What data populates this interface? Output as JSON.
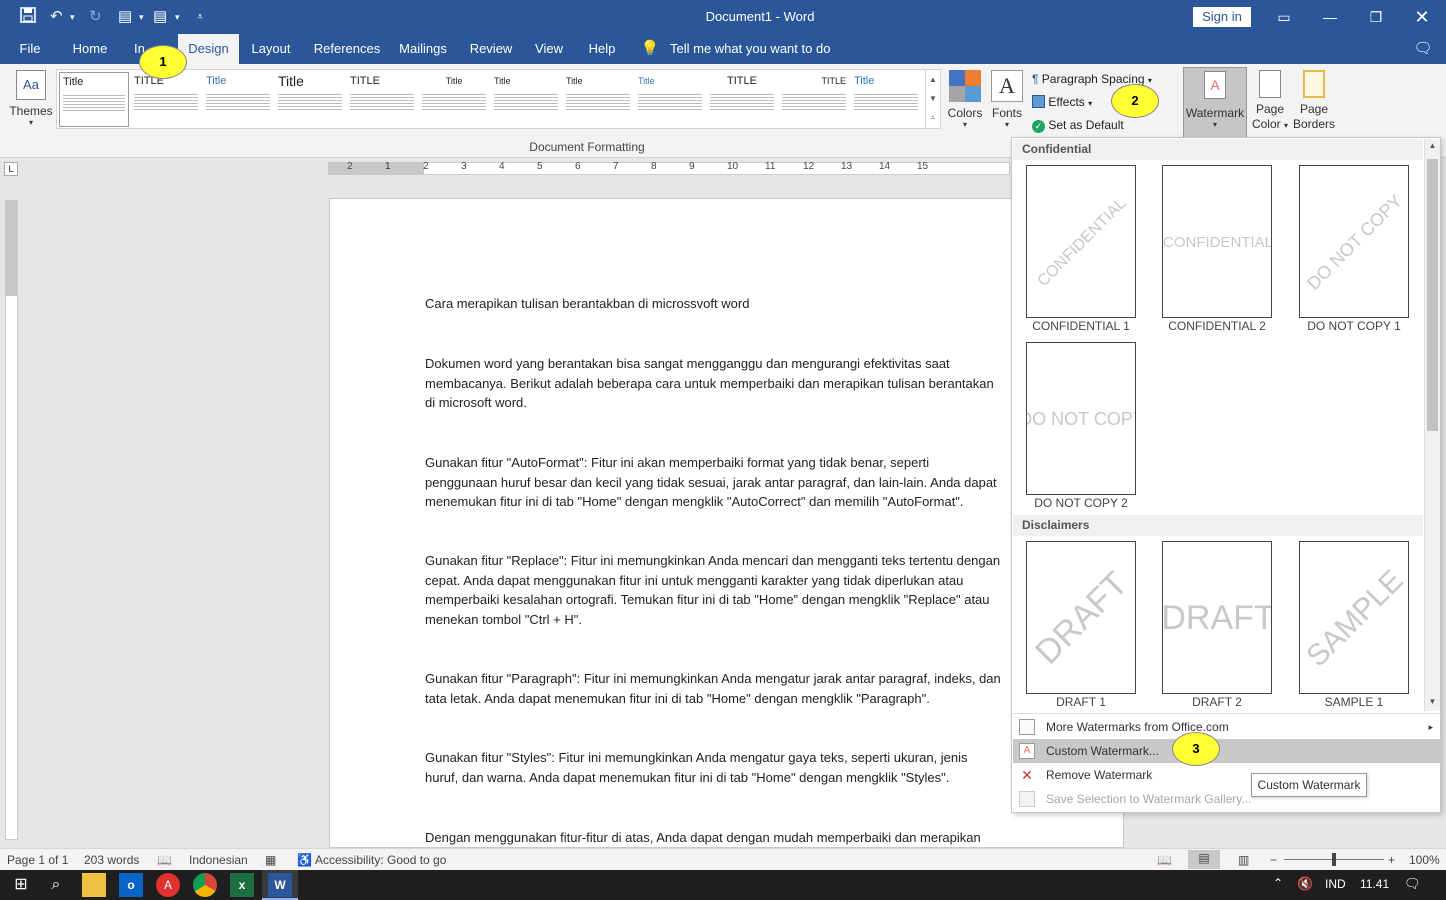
{
  "window": {
    "title": "Document1  -  Word",
    "sign_in": "Sign in"
  },
  "colors": {
    "brand": "#2b579a",
    "callout": "#ffff33"
  },
  "tabs": [
    "File",
    "Home",
    "Insert",
    "Design",
    "Layout",
    "References",
    "Mailings",
    "Review",
    "View",
    "Help"
  ],
  "tab_partial": "In",
  "tell_me": "Tell me what you want to do",
  "ribbon": {
    "themes": "Themes",
    "style_set_titles": [
      "Title",
      "TITLE",
      "Title",
      "Title",
      "TITLE",
      "Title",
      "Title",
      "Title",
      "Title",
      "TITLE",
      "TITLE",
      "Title"
    ],
    "group_label": "Document Formatting",
    "colors": "Colors",
    "fonts": "Fonts",
    "fonts_glyph": "A",
    "paragraph_spacing": "Paragraph Spacing",
    "effects": "Effects",
    "set_default": "Set as Default",
    "watermark": "Watermark",
    "page_color_1": "Page",
    "page_color_2": "Color",
    "page_borders_1": "Page",
    "page_borders_2": "Borders"
  },
  "ruler_numbers": [
    "2",
    "1",
    "1",
    "2",
    "3",
    "4",
    "5",
    "6",
    "7",
    "8",
    "9",
    "10",
    "11",
    "12",
    "13",
    "14",
    "15"
  ],
  "document": {
    "paragraphs": [
      "Cara merapikan tulisan berantakban di microssvoft word",
      "Dokumen word yang berantakan bisa sangat mengganggu dan mengurangi efektivitas saat\nmembacanya. Berikut adalah beberapa cara untuk memperbaiki dan merapikan tulisan berantakan\ndi microsoft word.",
      "Gunakan fitur \"AutoFormat\": Fitur ini akan memperbaiki format yang tidak benar, seperti\npenggunaan huruf besar dan kecil yang tidak sesuai, jarak antar paragraf, dan lain-lain. Anda dapat\nmenemukan fitur ini di tab \"Home\" dengan mengklik \"AutoCorrect\" dan memilih \"AutoFormat\".",
      "Gunakan fitur \"Replace\": Fitur ini memungkinkan Anda mencari dan mengganti teks tertentu dengan\ncepat. Anda dapat menggunakan fitur ini untuk mengganti karakter yang tidak diperlukan atau\nmemperbaiki kesalahan ortografi. Temukan fitur ini di tab \"Home\" dengan mengklik \"Replace\" atau\nmenekan tombol \"Ctrl + H\".",
      "Gunakan fitur \"Paragraph\": Fitur ini memungkinkan Anda mengatur jarak antar paragraf, indeks, dan\ntata letak. Anda dapat menemukan fitur ini di tab \"Home\" dengan mengklik \"Paragraph\".",
      "Gunakan fitur \"Styles\": Fitur ini memungkinkan Anda mengatur gaya teks, seperti ukuran, jenis\nhuruf, dan warna. Anda dapat menemukan fitur ini di tab \"Home\" dengan mengklik \"Styles\".",
      "Dengan menggunakan fitur-fitur di atas, Anda dapat dengan mudah memperbaiki dan merapikan"
    ]
  },
  "watermark_menu": {
    "section_confidential": "Confidential",
    "section_disclaimers": "Disclaimers",
    "items": [
      {
        "text": "CONFIDENTIAL",
        "label": "CONFIDENTIAL 1"
      },
      {
        "text": "CONFIDENTIAL",
        "label": "CONFIDENTIAL 2"
      },
      {
        "text": "DO NOT COPY",
        "label": "DO NOT COPY 1"
      },
      {
        "text": "DO NOT COPY",
        "label": "DO NOT COPY 2"
      },
      {
        "text": "DRAFT",
        "label": "DRAFT 1"
      },
      {
        "text": "DRAFT",
        "label": "DRAFT 2"
      },
      {
        "text": "SAMPLE",
        "label": "SAMPLE 1"
      }
    ],
    "more": "More Watermarks from Office.com",
    "custom": "Custom Watermark...",
    "remove": "Remove Watermark",
    "save": "Save Selection to Watermark Gallery...",
    "tooltip": "Custom Watermark"
  },
  "callouts": [
    "1",
    "2",
    "3"
  ],
  "status": {
    "page": "Page 1 of 1",
    "words": "203 words",
    "language": "Indonesian",
    "accessibility": "Accessibility: Good to go",
    "zoom": "100%"
  },
  "taskbar": {
    "lang": "IND",
    "time": "11.41"
  }
}
